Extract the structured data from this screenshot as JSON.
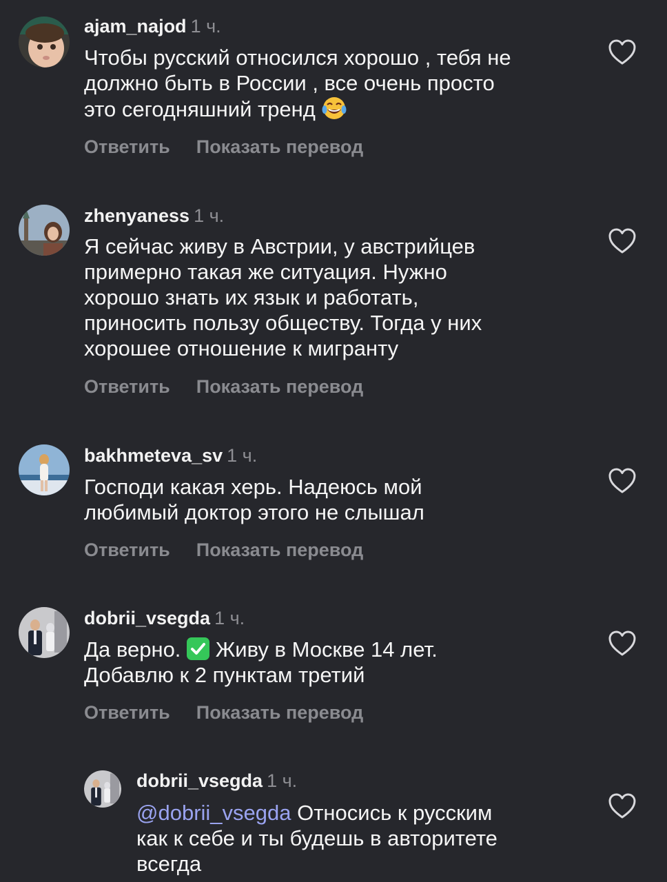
{
  "comments": [
    {
      "username": "ajam_najod",
      "time": "1 ч.",
      "lines": [
        "Чтобы русский относился хорошо , тебя не",
        "должно быть в России , все очень просто",
        "это сегодняшний тренд"
      ],
      "emoji": "tears-of-joy-emoji",
      "reply": "Ответить",
      "translate": "Показать перевод"
    },
    {
      "username": "zhenyaness",
      "time": "1 ч.",
      "lines": [
        "Я сейчас живу в Австрии, у австрийцев",
        "примерно такая же ситуация. Нужно",
        "хорошо знать их язык и работать,",
        "приносить пользу обществу. Тогда у них",
        "хорошее отношение к мигранту"
      ],
      "reply": "Ответить",
      "translate": "Показать перевод"
    },
    {
      "username": "bakhmeteva_sv",
      "time": "1 ч.",
      "lines": [
        "Господи какая херь. Надеюсь мой",
        "любимый доктор этого не слышал"
      ],
      "reply": "Ответить",
      "translate": "Показать перевод"
    },
    {
      "username": "dobrii_vsegda",
      "time": "1 ч.",
      "line1_before": "Да верно.",
      "line1_emoji": "check-mark-emoji",
      "line1_after": "Живу в Москве 14 лет.",
      "line2": "Добавлю к 2 пунктам третий",
      "reply": "Ответить",
      "translate": "Показать перевод"
    },
    {
      "username": "dobrii_vsegda",
      "time": "1 ч.",
      "mention": "@dobrii_vsegda",
      "line1_after": "Относись к русским",
      "line2": "как к себе и ты будешь в авторитете",
      "line3": "всегда"
    }
  ],
  "colors": {
    "background": "#26272c",
    "text": "#f5f5f5",
    "muted": "#8e8e93",
    "mention": "#9aa3f0",
    "check_green": "#35c759"
  }
}
